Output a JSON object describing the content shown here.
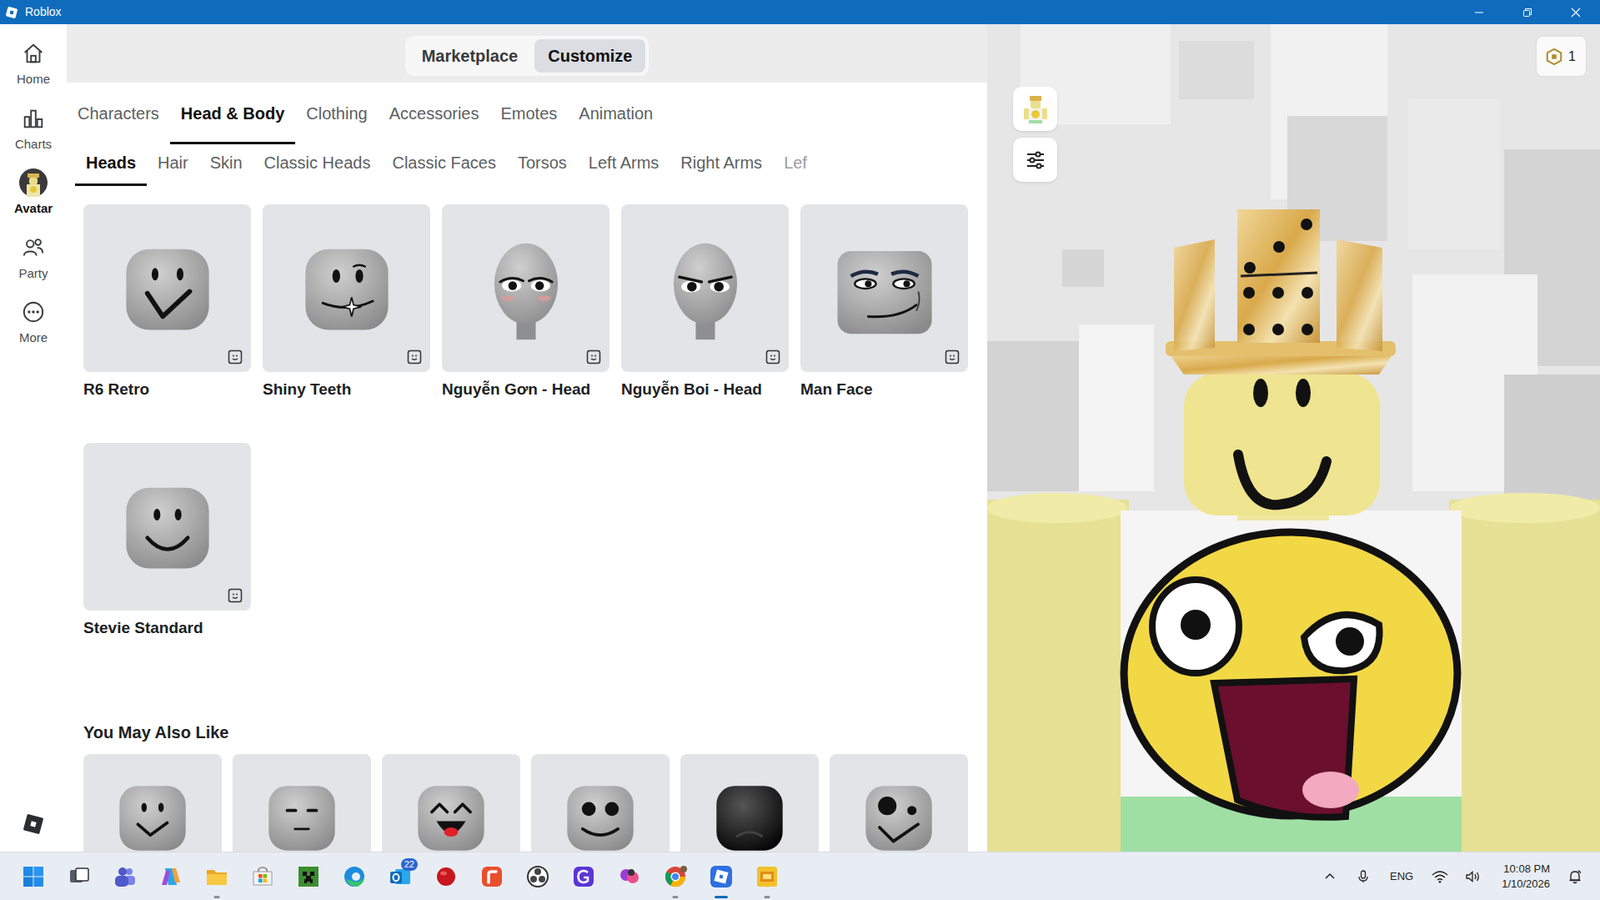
{
  "window": {
    "title": "Roblox"
  },
  "sidebar": {
    "items": [
      {
        "label": "Home",
        "selected": false
      },
      {
        "label": "Charts",
        "selected": false
      },
      {
        "label": "Avatar",
        "selected": true
      },
      {
        "label": "Party",
        "selected": false
      },
      {
        "label": "More",
        "selected": false
      }
    ]
  },
  "mode_toggle": [
    {
      "label": "Marketplace",
      "selected": false
    },
    {
      "label": "Customize",
      "selected": true
    }
  ],
  "robux": {
    "count": "1"
  },
  "tabs": [
    {
      "label": "Characters",
      "selected": false
    },
    {
      "label": "Head & Body",
      "selected": true
    },
    {
      "label": "Clothing",
      "selected": false
    },
    {
      "label": "Accessories",
      "selected": false
    },
    {
      "label": "Emotes",
      "selected": false
    },
    {
      "label": "Animation",
      "selected": false
    }
  ],
  "subtabs": [
    {
      "label": "Heads",
      "selected": true
    },
    {
      "label": "Hair",
      "selected": false
    },
    {
      "label": "Skin",
      "selected": false
    },
    {
      "label": "Classic Heads",
      "selected": false
    },
    {
      "label": "Classic Faces",
      "selected": false
    },
    {
      "label": "Torsos",
      "selected": false
    },
    {
      "label": "Left Arms",
      "selected": false
    },
    {
      "label": "Right Arms",
      "selected": false
    },
    {
      "label": "Lef",
      "selected": false
    }
  ],
  "items": [
    {
      "label": "R6 Retro",
      "kind": "retro"
    },
    {
      "label": "Shiny Teeth",
      "kind": "teeth"
    },
    {
      "label": "Nguyễn Gơn - Head",
      "kind": "anime-girl"
    },
    {
      "label": "Nguyễn Boi - Head",
      "kind": "anime-boy"
    },
    {
      "label": "Man Face",
      "kind": "man"
    },
    {
      "label": "Stevie Standard",
      "kind": "stevie"
    }
  ],
  "recommended": {
    "title": "You May Also Like",
    "items": [
      {
        "kind": "dots"
      },
      {
        "kind": "sleepy"
      },
      {
        "kind": "happy"
      },
      {
        "kind": "bigdots"
      },
      {
        "kind": "dark"
      },
      {
        "kind": "bigeye"
      }
    ]
  },
  "taskbar": {
    "apps": [
      {
        "kind": "start",
        "running": false,
        "active": false
      },
      {
        "kind": "taskview",
        "running": false,
        "active": false
      },
      {
        "kind": "teams",
        "running": false,
        "active": false
      },
      {
        "kind": "copilot",
        "running": false,
        "active": false
      },
      {
        "kind": "explorer",
        "running": true,
        "active": false
      },
      {
        "kind": "store",
        "running": false,
        "active": false
      },
      {
        "kind": "minecraft",
        "running": false,
        "active": false
      },
      {
        "kind": "edge",
        "running": false,
        "active": false
      },
      {
        "kind": "outlook",
        "running": false,
        "active": false,
        "badge": "22"
      },
      {
        "kind": "redball",
        "running": false,
        "active": false
      },
      {
        "kind": "redsquare",
        "running": false,
        "active": false
      },
      {
        "kind": "obs",
        "running": false,
        "active": false
      },
      {
        "kind": "purple",
        "running": false,
        "active": false
      },
      {
        "kind": "pink",
        "running": false,
        "active": false
      },
      {
        "kind": "chrome",
        "running": true,
        "active": false
      },
      {
        "kind": "roblox",
        "running": true,
        "active": true
      },
      {
        "kind": "yellow",
        "running": true,
        "active": false
      }
    ],
    "language": "ENG",
    "time": "10:08 PM",
    "date": "1/10/2026"
  }
}
